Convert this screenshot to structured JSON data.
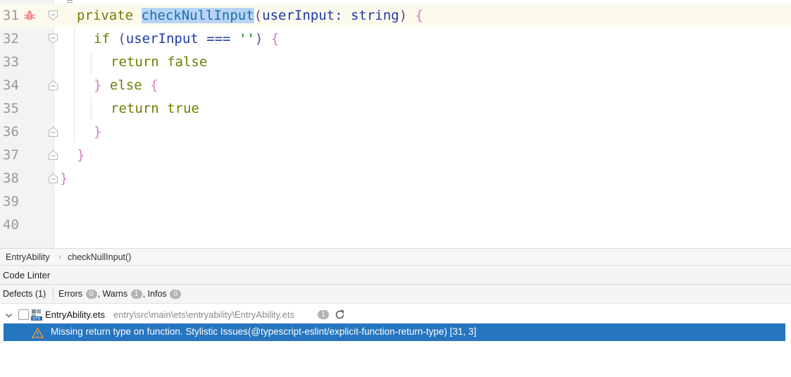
{
  "editor": {
    "line_numbers": [
      "31",
      "32",
      "33",
      "34",
      "35",
      "36",
      "37",
      "38",
      "39",
      "40"
    ],
    "code": {
      "l31_kw": "private ",
      "l31_fn": "checkNullInput",
      "l31_paren_open": "(",
      "l31_param": "userInput",
      "l31_colon": ": ",
      "l31_type": "string",
      "l31_paren_close": ")",
      "l31_brace": " {",
      "l32_kw": "if ",
      "l32_paren_open": "(",
      "l32_param": "userInput",
      "l32_op": " === ",
      "l32_str": "''",
      "l32_paren_close": ")",
      "l32_brace": " {",
      "l33_kw": "return false",
      "l34_brace": "} ",
      "l34_kw": "else",
      "l34_brace2": " {",
      "l35_kw": "return true",
      "l36_brace": "}",
      "l37_brace": "}",
      "l38_brace": "}"
    }
  },
  "breadcrumb": {
    "items": [
      "EntryAbility",
      "checkNullInput()"
    ],
    "separator": "›"
  },
  "panel": {
    "title": "Code Linter",
    "defects_tab": "Defects (1)",
    "errors_label": "Errors",
    "errors_count": "0",
    "warns_label": ", Warns",
    "warns_count": "1",
    "infos_label": ", Infos",
    "infos_count": "0"
  },
  "tree": {
    "file_name": "EntryAbility.ets",
    "file_path": "entry\\src\\main\\ets\\entryability\\EntryAbility.ets",
    "file_issue_count": "1",
    "issue_text": "Missing return type on function. Stylistic Issues(@typescript-eslint/explicit-function-return-type) [31, 3]"
  },
  "colors": {
    "keyword": "#727d00",
    "selection": "#b7d4f6",
    "selected_row": "#2675bf",
    "brace": "#d67ec0"
  }
}
